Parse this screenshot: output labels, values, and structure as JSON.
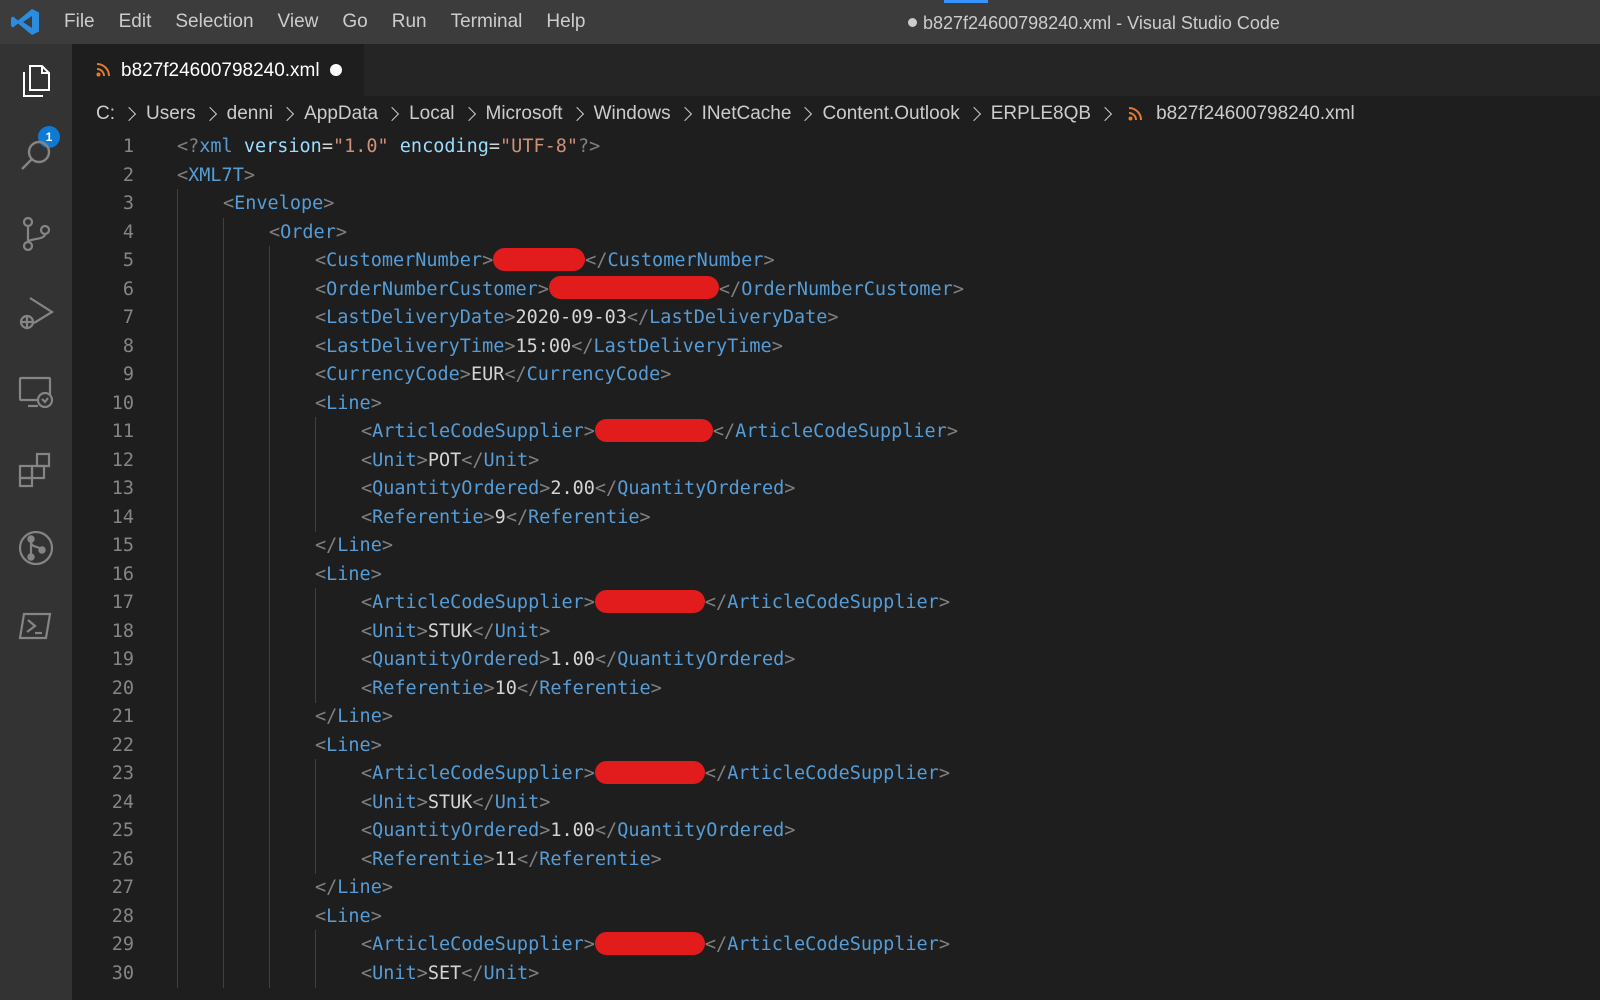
{
  "window": {
    "title": "b827f24600798240.xml - Visual Studio Code",
    "menu": [
      "File",
      "Edit",
      "Selection",
      "View",
      "Go",
      "Run",
      "Terminal",
      "Help"
    ]
  },
  "activity": {
    "icons": [
      "files-icon",
      "search-icon",
      "source-control-icon",
      "run-debug-icon",
      "remote-explorer-icon",
      "extensions-icon",
      "git-graph-icon",
      "powershell-icon"
    ],
    "explorer_badge": "1"
  },
  "tab": {
    "filename": "b827f24600798240.xml",
    "modified": true
  },
  "breadcrumbs": [
    "C:",
    "Users",
    "denni",
    "AppData",
    "Local",
    "Microsoft",
    "Windows",
    "INetCache",
    "Content.Outlook",
    "ERPLE8QB",
    "b827f24600798240.xml"
  ],
  "code": {
    "line_numbers": [
      "1",
      "2",
      "3",
      "4",
      "5",
      "6",
      "7",
      "8",
      "9",
      "10",
      "11",
      "12",
      "13",
      "14",
      "15",
      "16",
      "17",
      "18",
      "19",
      "20",
      "21",
      "22",
      "23",
      "24",
      "25",
      "26",
      "27",
      "28",
      "29",
      "30"
    ],
    "xml_decl": {
      "name": "xml",
      "attr1": "version",
      "val1": "\"1.0\"",
      "attr2": "encoding",
      "val2": "\"UTF-8\""
    },
    "tags": {
      "root": "XML7T",
      "envelope": "Envelope",
      "order": "Order",
      "customer_number": "CustomerNumber",
      "order_number_customer": "OrderNumberCustomer",
      "last_delivery_date": "LastDeliveryDate",
      "last_delivery_time": "LastDeliveryTime",
      "currency_code": "CurrencyCode",
      "line": "Line",
      "article_code_supplier": "ArticleCodeSupplier",
      "unit": "Unit",
      "quantity_ordered": "QuantityOrdered",
      "referentie": "Referentie"
    },
    "order": {
      "last_delivery_date": "2020-09-03",
      "last_delivery_time": "15:00",
      "currency_code": "EUR"
    },
    "lines": [
      {
        "unit": "POT",
        "quantity": "2.00",
        "referentie": "9"
      },
      {
        "unit": "STUK",
        "quantity": "1.00",
        "referentie": "10"
      },
      {
        "unit": "STUK",
        "quantity": "1.00",
        "referentie": "11"
      },
      {
        "unit": "SET"
      }
    ]
  }
}
